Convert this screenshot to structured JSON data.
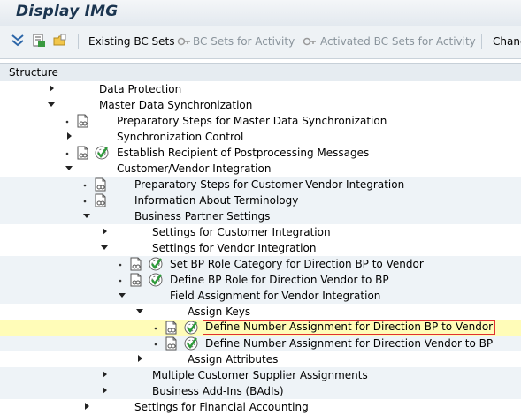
{
  "window": {
    "title": "Display IMG"
  },
  "toolbar": {
    "existing_bc_sets": "Existing BC Sets",
    "bc_sets_for_activity": "BC Sets for Activity",
    "activated_bc_sets_for_activity": "Activated BC Sets for Activity",
    "change": "Change"
  },
  "structure": {
    "header": "Structure"
  },
  "tree": [
    {
      "label": "Data Protection"
    },
    {
      "label": "Master Data Synchronization"
    },
    {
      "label": "Preparatory Steps for Master Data Synchronization"
    },
    {
      "label": "Synchronization Control"
    },
    {
      "label": "Establish Recipient of Postprocessing Messages"
    },
    {
      "label": "Customer/Vendor Integration"
    },
    {
      "label": "Preparatory Steps for Customer-Vendor Integration"
    },
    {
      "label": "Information About Terminology"
    },
    {
      "label": "Business Partner Settings"
    },
    {
      "label": "Settings for Customer Integration"
    },
    {
      "label": "Settings for Vendor Integration"
    },
    {
      "label": "Set BP Role Category for Direction BP to Vendor"
    },
    {
      "label": "Define BP Role for Direction Vendor to BP"
    },
    {
      "label": "Field Assignment for Vendor Integration"
    },
    {
      "label": "Assign Keys"
    },
    {
      "label": "Define Number Assignment for Direction BP to Vendor"
    },
    {
      "label": "Define Number Assignment for Direction Vendor to BP"
    },
    {
      "label": "Assign Attributes"
    },
    {
      "label": "Multiple Customer Supplier Assignments"
    },
    {
      "label": "Business Add-Ins (BAdIs)"
    },
    {
      "label": "Settings for Financial Accounting"
    }
  ],
  "colors": {
    "title_text": "#1b3550",
    "row_alt": "#eef3f7",
    "selected_row": "#fffcb8",
    "focus_outline": "#e03030",
    "check_green": "#2e9b3a"
  }
}
